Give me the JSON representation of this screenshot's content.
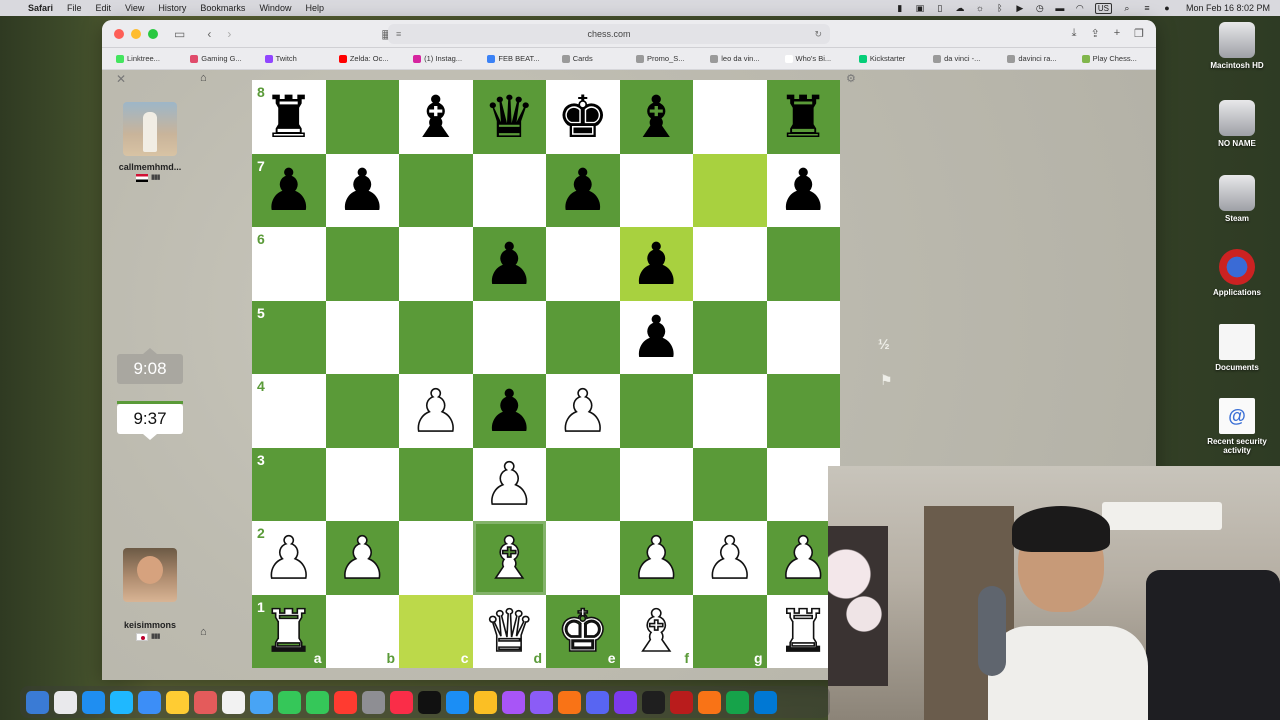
{
  "menubar": {
    "app": "Safari",
    "menus": [
      "File",
      "Edit",
      "View",
      "History",
      "Bookmarks",
      "Window",
      "Help"
    ],
    "input_source": "US",
    "datetime": "Mon Feb 16  8:02 PM"
  },
  "browser": {
    "url": "chess.com",
    "bookmarks": [
      {
        "label": "Linktree...",
        "color": "#43e55e"
      },
      {
        "label": "Gaming G...",
        "color": "#e04b6b"
      },
      {
        "label": "Twitch",
        "color": "#9146ff"
      },
      {
        "label": "Zelda: Oc...",
        "color": "#ff0000"
      },
      {
        "label": "(1) Instag...",
        "color": "#d6249f"
      },
      {
        "label": "FEB BEAT...",
        "color": "#3b82f6"
      },
      {
        "label": "Cards",
        "color": "#9a9a9a"
      },
      {
        "label": "Promo_S...",
        "color": "#9a9a9a"
      },
      {
        "label": "leo da vin...",
        "color": "#9a9a9a"
      },
      {
        "label": "Who's Bi...",
        "color": "#ffffff"
      },
      {
        "label": "Kickstarter",
        "color": "#05ce78"
      },
      {
        "label": "da vinci -...",
        "color": "#9a9a9a"
      },
      {
        "label": "davinci ra...",
        "color": "#9a9a9a"
      },
      {
        "label": "Play Chess...",
        "color": "#81b64c"
      }
    ]
  },
  "game": {
    "opponent": {
      "name": "callmemhmd...",
      "country": "Sudan",
      "clock": "9:08"
    },
    "player": {
      "name": "keisimmons",
      "country": "Japan",
      "clock": "9:37"
    },
    "draw_label": "½",
    "ranks": [
      "8",
      "7",
      "6",
      "5",
      "4",
      "3",
      "2",
      "1"
    ],
    "files": [
      "a",
      "b",
      "c",
      "d",
      "e",
      "f",
      "g",
      "h"
    ],
    "board": [
      [
        "bR",
        "",
        "bB",
        "bQ",
        "bK",
        "bB",
        "",
        "bR"
      ],
      [
        "bP",
        "bP",
        "",
        "",
        "bP",
        "",
        "",
        "bP"
      ],
      [
        "",
        "",
        "",
        "bP",
        "",
        "bP",
        "",
        ""
      ],
      [
        "",
        "",
        "",
        "",
        "",
        "bP",
        "",
        ""
      ],
      [
        "",
        "",
        "wP",
        "bP",
        "wP",
        "",
        "",
        ""
      ],
      [
        "",
        "",
        "",
        "wP",
        "",
        "",
        "",
        ""
      ],
      [
        "wP",
        "wP",
        "",
        "wB",
        "",
        "wP",
        "wP",
        "wP"
      ],
      [
        "wR",
        "",
        "",
        "wQ",
        "wK",
        "wB",
        "",
        "wR"
      ]
    ],
    "highlights": [
      [
        1,
        6,
        "hl"
      ],
      [
        2,
        5,
        "hl"
      ],
      [
        7,
        2,
        "hl2"
      ]
    ],
    "selected": [
      6,
      3
    ]
  },
  "desktop": [
    {
      "label": "Macintosh HD",
      "icon": "disk-icon"
    },
    {
      "label": "NO NAME",
      "icon": "disk-icon"
    },
    {
      "label": "Steam",
      "icon": "disk-icon"
    },
    {
      "label": "Applications",
      "icon": "steam-icon"
    },
    {
      "label": "Documents",
      "icon": "document-icon"
    },
    {
      "label": "Recent security activity",
      "icon": "http-icon"
    }
  ],
  "dock_colors": [
    "#3a7bd5",
    "#e9e9ec",
    "#1f8ef1",
    "#1fb8ff",
    "#3c8ef7",
    "#ffcc33",
    "#e45b5b",
    "#f2f2f2",
    "#48a4f5",
    "#35c759",
    "#35c759",
    "#ff3b30",
    "#8e8e93",
    "#fa2d48",
    "#111111",
    "#1b8ef5",
    "#fbbf24",
    "#a855f7",
    "#8b5cf6",
    "#f97316",
    "#5865f2",
    "#7c3aed",
    "#1f1f1f",
    "#b91c1c",
    "#f97316",
    "#16a34a",
    "#0078d4"
  ]
}
